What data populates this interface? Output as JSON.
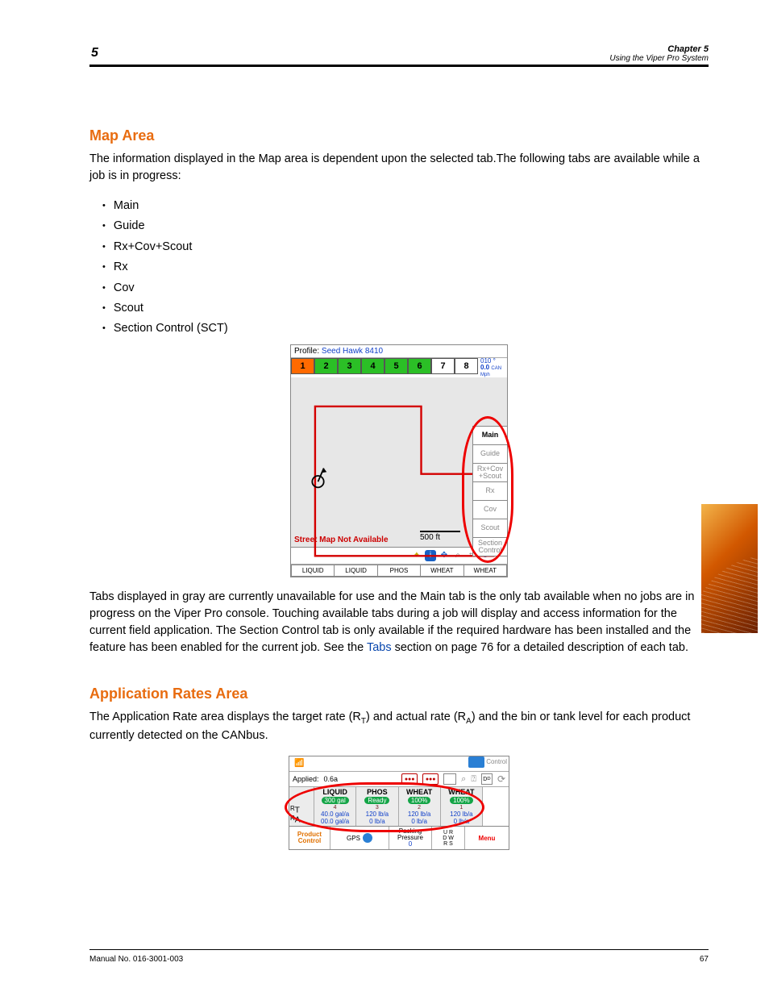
{
  "header": {
    "chapter_num": "5",
    "right1": "Chapter 5",
    "right2": "Using the Viper Pro System"
  },
  "section_intro": {
    "title": "Map Area",
    "p1": "The information displayed in the Map area is dependent upon the selected tab.The following tabs are available while a job is in progress:",
    "tab_list": [
      "Main",
      "Guide",
      "Rx+Cov+Scout",
      "Rx",
      "Cov",
      "Scout",
      "Section Control (SCT)"
    ],
    "p2a": "Tabs displayed in gray are currently unavailable for use and the Main tab is the only tab available when no jobs are in progress on the Viper Pro console. Touching available tabs during a job will display and access information for the current field application. The Section Control tab is only available if the required hardware has been installed and the feature has been enabled for the current job. See the ",
    "p2_link": "Tabs",
    "p2b": " section on page 76 for a detailed description of each tab."
  },
  "map_ui": {
    "profile_label": "Profile:",
    "profile_name": "Seed Hawk 8410",
    "sections": [
      "1",
      "2",
      "3",
      "4",
      "5",
      "6",
      "7",
      "8"
    ],
    "gps_heading": "010 °",
    "gps_speed": "0.0",
    "gps_units": "CAN Mph",
    "street_msg": "Street Map Not Available",
    "scale": "500 ft",
    "side_tabs": [
      "Main",
      "Guide",
      "Rx+Cov +Scout",
      "Rx",
      "Cov",
      "Scout",
      "Section Control"
    ],
    "product_tabs": [
      "LIQUID",
      "LIQUID",
      "PHOS",
      "WHEAT",
      "WHEAT"
    ]
  },
  "rates_section": {
    "title": "Application Rates Area",
    "p1a": "The Application Rate area displays the target rate (R",
    "p1b": ") and actual rate (R",
    "p1c": ") and the bin or tank level for each product currently detected on the CANbus."
  },
  "rate_ui": {
    "top_right": "Control",
    "applied_label": "Applied:",
    "applied_value": "0.6a",
    "row_labels": [
      "R",
      "R"
    ],
    "row_sub": [
      "T",
      "A"
    ],
    "cols": [
      {
        "hdr": "LIQUID",
        "pill": "300 gal",
        "num": "4",
        "tgt": "40.0 gal/a",
        "act": "00.0 gal/a"
      },
      {
        "hdr": "PHOS",
        "pill": "Ready",
        "num": "3",
        "tgt": "120 lb/a",
        "act": "0 lb/a"
      },
      {
        "hdr": "WHEAT",
        "pill": "100%",
        "num": "2",
        "tgt": "120 lb/a",
        "act": "0 lb/a"
      },
      {
        "hdr": "WHEAT",
        "pill": "100%",
        "num": "1",
        "tgt": "120 lb/a",
        "act": "0 lb/a"
      }
    ],
    "bottom": {
      "pc1": "Product",
      "pc2": "Control",
      "gps": "GPS",
      "pp1": "Packing",
      "pp2": "Pressure",
      "pp3": "0",
      "s1": "U    R",
      "s2": "D    W",
      "s3": "R    S",
      "menu": "Menu"
    }
  },
  "footer": {
    "left": "Manual No. 016-3001-003",
    "right": "67"
  }
}
